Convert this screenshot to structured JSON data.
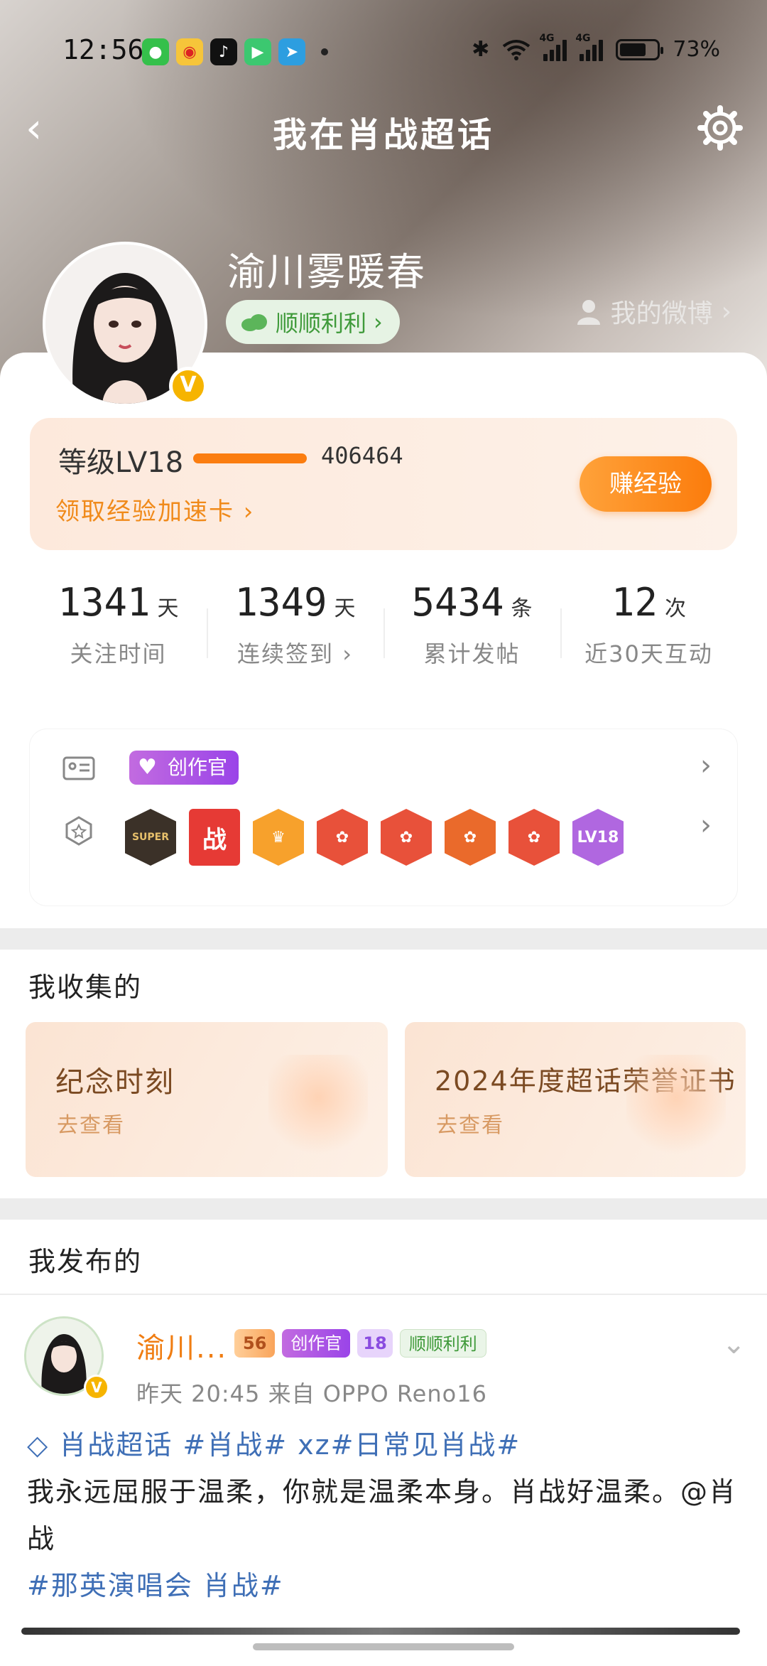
{
  "status_bar": {
    "time": "12:56",
    "battery": "73%",
    "net1": "4G",
    "net2": "4G"
  },
  "nav": {
    "title": "我在肖战超话"
  },
  "profile": {
    "username": "渝川雾暖春",
    "badge_text": "顺顺利利",
    "my_weibo": "我的微博"
  },
  "level": {
    "label": "等级LV18",
    "exp": "406464",
    "progress": 0.95,
    "boost_link": "领取经验加速卡",
    "earn_button": "赚经验"
  },
  "stats": [
    {
      "num": "1341",
      "unit": "天",
      "label": "关注时间"
    },
    {
      "num": "1349",
      "unit": "天",
      "label": "连续签到"
    },
    {
      "num": "5434",
      "unit": "条",
      "label": "累计发帖"
    },
    {
      "num": "12",
      "unit": "次",
      "label": "近30天互动"
    }
  ],
  "badges": {
    "creator": "创作官",
    "medals": [
      "SUPER",
      "战",
      "",
      "",
      "",
      "",
      "",
      "LV18"
    ]
  },
  "collections": {
    "title": "我收集的",
    "items": [
      {
        "title": "纪念时刻",
        "sub": "去查看"
      },
      {
        "title": "2024年度超话荣誉证书",
        "sub": "去查看"
      }
    ]
  },
  "posts": {
    "title": "我发布的",
    "item": {
      "name": "渝川...",
      "tag_level": "56",
      "tag_creator": "创作官",
      "tag_diamond": "18",
      "tag_green": "顺顺利利",
      "meta": "昨天 20:45  来自 OPPO Reno16",
      "line1": "肖战超话 #肖战# xz#日常见肖战#",
      "line2": "我永远屈服于温柔，你就是温柔本身。肖战好温柔。@肖战",
      "line3": "#那英演唱会 肖战#"
    }
  }
}
